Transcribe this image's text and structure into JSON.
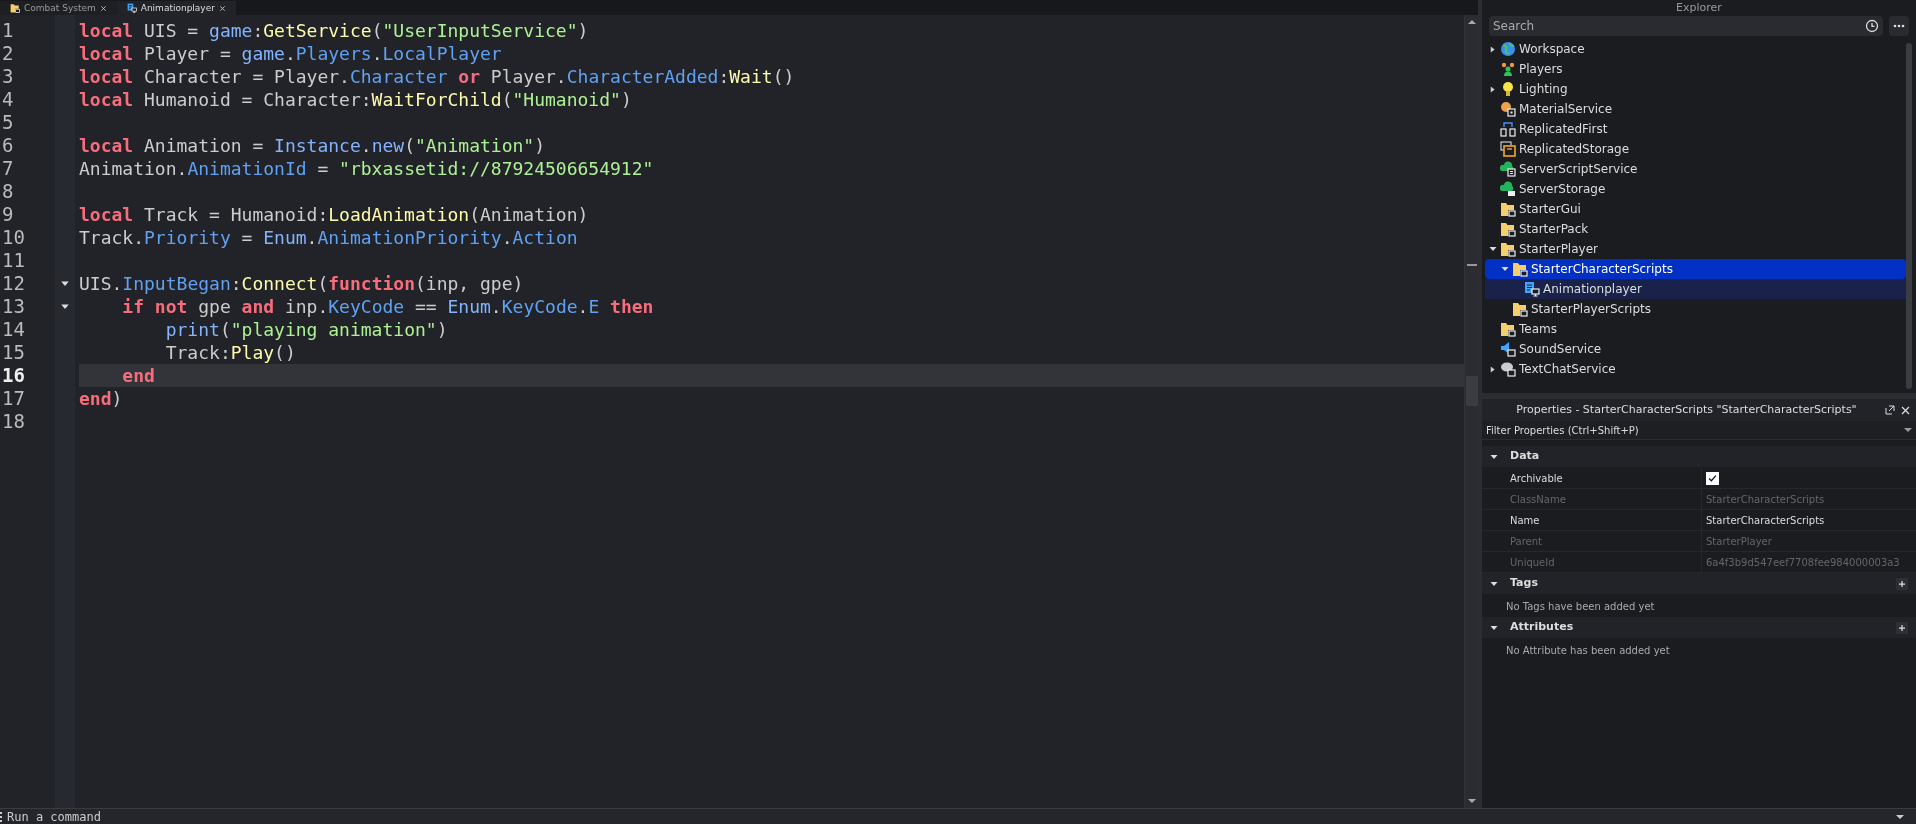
{
  "tabs": [
    {
      "label": "Combat System",
      "kind": "folder",
      "selected": false
    },
    {
      "label": "Animationplayer",
      "kind": "script",
      "selected": true
    }
  ],
  "editor": {
    "lines": [
      {
        "number": "1",
        "foldable": false,
        "selected": false,
        "tokens": [
          {
            "kind": "keyword",
            "text": "local"
          },
          {
            "kind": "text",
            "text": " UIS = "
          },
          {
            "kind": "builtin",
            "text": "game"
          },
          {
            "kind": "text",
            "text": ":"
          },
          {
            "kind": "method",
            "text": "GetService"
          },
          {
            "kind": "text",
            "text": "("
          },
          {
            "kind": "string",
            "text": "\"UserInputService\""
          },
          {
            "kind": "text",
            "text": ")"
          }
        ]
      },
      {
        "number": "2",
        "foldable": false,
        "selected": false,
        "tokens": [
          {
            "kind": "keyword",
            "text": "local"
          },
          {
            "kind": "text",
            "text": " Player = "
          },
          {
            "kind": "builtin",
            "text": "game"
          },
          {
            "kind": "text",
            "text": "."
          },
          {
            "kind": "property",
            "text": "Players"
          },
          {
            "kind": "text",
            "text": "."
          },
          {
            "kind": "property",
            "text": "LocalPlayer"
          }
        ]
      },
      {
        "number": "3",
        "foldable": false,
        "selected": false,
        "tokens": [
          {
            "kind": "keyword",
            "text": "local"
          },
          {
            "kind": "text",
            "text": " Character = Player."
          },
          {
            "kind": "property",
            "text": "Character"
          },
          {
            "kind": "keyword",
            "text": " or"
          },
          {
            "kind": "text",
            "text": " Player."
          },
          {
            "kind": "property",
            "text": "CharacterAdded"
          },
          {
            "kind": "text",
            "text": ":"
          },
          {
            "kind": "method",
            "text": "Wait"
          },
          {
            "kind": "text",
            "text": "()"
          }
        ]
      },
      {
        "number": "4",
        "foldable": false,
        "selected": false,
        "tokens": [
          {
            "kind": "keyword",
            "text": "local"
          },
          {
            "kind": "text",
            "text": " Humanoid = Character:"
          },
          {
            "kind": "method",
            "text": "WaitForChild"
          },
          {
            "kind": "text",
            "text": "("
          },
          {
            "kind": "string",
            "text": "\"Humanoid\""
          },
          {
            "kind": "text",
            "text": ")"
          }
        ]
      },
      {
        "number": "5",
        "foldable": false,
        "selected": false
      },
      {
        "number": "6",
        "foldable": false,
        "selected": false,
        "tokens": [
          {
            "kind": "keyword",
            "text": "local"
          },
          {
            "kind": "text",
            "text": " Animation = "
          },
          {
            "kind": "builtin",
            "text": "Instance"
          },
          {
            "kind": "text",
            "text": "."
          },
          {
            "kind": "builtin",
            "text": "new"
          },
          {
            "kind": "text",
            "text": "("
          },
          {
            "kind": "string",
            "text": "\"Animation\""
          },
          {
            "kind": "text",
            "text": ")"
          }
        ]
      },
      {
        "number": "7",
        "foldable": false,
        "selected": false,
        "tokens": [
          {
            "kind": "text",
            "text": "Animation."
          },
          {
            "kind": "property",
            "text": "AnimationId"
          },
          {
            "kind": "text",
            "text": " = "
          },
          {
            "kind": "string",
            "text": "\"rbxassetid://87924506654912\""
          }
        ]
      },
      {
        "number": "8",
        "foldable": false,
        "selected": false
      },
      {
        "number": "9",
        "foldable": false,
        "selected": false,
        "tokens": [
          {
            "kind": "keyword",
            "text": "local"
          },
          {
            "kind": "text",
            "text": " Track = Humanoid:"
          },
          {
            "kind": "method",
            "text": "LoadAnimation"
          },
          {
            "kind": "text",
            "text": "(Animation)"
          }
        ]
      },
      {
        "number": "10",
        "foldable": false,
        "selected": false,
        "tokens": [
          {
            "kind": "text",
            "text": "Track."
          },
          {
            "kind": "property",
            "text": "Priority"
          },
          {
            "kind": "text",
            "text": " = "
          },
          {
            "kind": "builtin",
            "text": "Enum"
          },
          {
            "kind": "text",
            "text": "."
          },
          {
            "kind": "property",
            "text": "AnimationPriority"
          },
          {
            "kind": "text",
            "text": "."
          },
          {
            "kind": "property",
            "text": "Action"
          }
        ]
      },
      {
        "number": "11",
        "foldable": false,
        "selected": false
      },
      {
        "number": "12",
        "foldable": true,
        "selected": false,
        "tokens": [
          {
            "kind": "text",
            "text": "UIS."
          },
          {
            "kind": "property",
            "text": "InputBegan"
          },
          {
            "kind": "text",
            "text": ":"
          },
          {
            "kind": "method",
            "text": "Connect"
          },
          {
            "kind": "text",
            "text": "("
          },
          {
            "kind": "keyword",
            "text": "function"
          },
          {
            "kind": "text",
            "text": "(inp, gpe)"
          }
        ]
      },
      {
        "number": "13",
        "foldable": true,
        "selected": false,
        "tokens": [
          {
            "kind": "keyword",
            "text": "    if"
          },
          {
            "kind": "keyword",
            "text": " not"
          },
          {
            "kind": "text",
            "text": " gpe "
          },
          {
            "kind": "keyword",
            "text": "and"
          },
          {
            "kind": "text",
            "text": " inp."
          },
          {
            "kind": "property",
            "text": "KeyCode"
          },
          {
            "kind": "text",
            "text": " == "
          },
          {
            "kind": "builtin",
            "text": "Enum"
          },
          {
            "kind": "text",
            "text": "."
          },
          {
            "kind": "property",
            "text": "KeyCode"
          },
          {
            "kind": "text",
            "text": "."
          },
          {
            "kind": "property",
            "text": "E"
          },
          {
            "kind": "keyword",
            "text": " then"
          }
        ]
      },
      {
        "number": "14",
        "foldable": false,
        "selected": false,
        "tokens": [
          {
            "kind": "builtin",
            "text": "        print"
          },
          {
            "kind": "text",
            "text": "("
          },
          {
            "kind": "string",
            "text": "\"playing animation\""
          },
          {
            "kind": "text",
            "text": ")"
          }
        ]
      },
      {
        "number": "15",
        "foldable": false,
        "selected": false,
        "tokens": [
          {
            "kind": "text",
            "text": "        Track:"
          },
          {
            "kind": "method",
            "text": "Play"
          },
          {
            "kind": "text",
            "text": "()"
          }
        ]
      },
      {
        "number": "16",
        "foldable": false,
        "selected": true,
        "tokens": [
          {
            "kind": "keyword",
            "text": "    end"
          }
        ]
      },
      {
        "number": "17",
        "foldable": false,
        "selected": false,
        "tokens": [
          {
            "kind": "keyword",
            "text": "end"
          },
          {
            "kind": "text",
            "text": ")"
          }
        ]
      },
      {
        "number": "18",
        "foldable": false,
        "selected": false
      }
    ]
  },
  "explorer": {
    "title": "Explorer",
    "search": {
      "placeholder": "Search"
    },
    "items": [
      {
        "name": "Workspace",
        "kind": "globe",
        "expandable": true,
        "expanded": false,
        "selected": false
      },
      {
        "name": "Players",
        "kind": "people",
        "expandable": false,
        "selected": false
      },
      {
        "name": "Lighting",
        "kind": "bulb",
        "expandable": true,
        "expanded": false,
        "selected": false
      },
      {
        "name": "MaterialService",
        "kind": "service",
        "expandable": false,
        "selected": false
      },
      {
        "name": "ReplicatedFirst",
        "kind": "network",
        "expandable": false,
        "selected": false
      },
      {
        "name": "ReplicatedStorage",
        "kind": "storage",
        "expandable": false,
        "selected": false
      },
      {
        "name": "ServerScriptService",
        "kind": "cloud-script",
        "expandable": false,
        "selected": false
      },
      {
        "name": "ServerStorage",
        "kind": "cloud",
        "expandable": false,
        "selected": false
      },
      {
        "name": "StarterGui",
        "kind": "folder",
        "expandable": false,
        "selected": false
      },
      {
        "name": "StarterPack",
        "kind": "folder",
        "expandable": false,
        "selected": false
      },
      {
        "name": "StarterPlayer",
        "kind": "folder",
        "expandable": true,
        "expanded": true,
        "selected": false,
        "children": [
          {
            "name": "StarterCharacterScripts",
            "kind": "folder",
            "expandable": true,
            "expanded": true,
            "selected": true,
            "children": [
              {
                "name": "Animationplayer",
                "kind": "script",
                "expandable": false,
                "selected": false
              }
            ]
          },
          {
            "name": "StarterPlayerScripts",
            "kind": "folder",
            "expandable": false,
            "selected": false
          }
        ]
      },
      {
        "name": "Teams",
        "kind": "folder",
        "expandable": false,
        "selected": false
      },
      {
        "name": "SoundService",
        "kind": "sound",
        "expandable": false,
        "selected": false
      },
      {
        "name": "TextChatService",
        "kind": "chat",
        "expandable": true,
        "expanded": false,
        "selected": false
      }
    ]
  },
  "properties": {
    "title": "Properties - StarterCharacterScripts \"StarterCharacterScripts\"",
    "filter": {
      "placeholder": "Filter Properties (Ctrl+Shift+P)"
    },
    "sections": [
      {
        "name": "Data",
        "expanded": true,
        "addable": false,
        "rows": [
          {
            "name": "Archivable",
            "kind": "checkbox",
            "checked": true,
            "disabled": false
          },
          {
            "name": "ClassName",
            "kind": "text",
            "value": "StarterCharacterScripts",
            "disabled": true
          },
          {
            "name": "Name",
            "kind": "text",
            "value": "StarterCharacterScripts",
            "disabled": false
          },
          {
            "name": "Parent",
            "kind": "text",
            "value": "StarterPlayer",
            "disabled": true
          },
          {
            "name": "UniqueId",
            "kind": "text",
            "value": "6a4f3b9d547eef7708fee984000003a3",
            "disabled": true
          }
        ]
      },
      {
        "name": "Tags",
        "expanded": true,
        "addable": true,
        "empty": "No Tags have been added yet"
      },
      {
        "name": "Attributes",
        "expanded": true,
        "addable": true,
        "empty": "No Attribute has been added yet"
      }
    ]
  },
  "command_bar": {
    "placeholder": "Run a command"
  }
}
